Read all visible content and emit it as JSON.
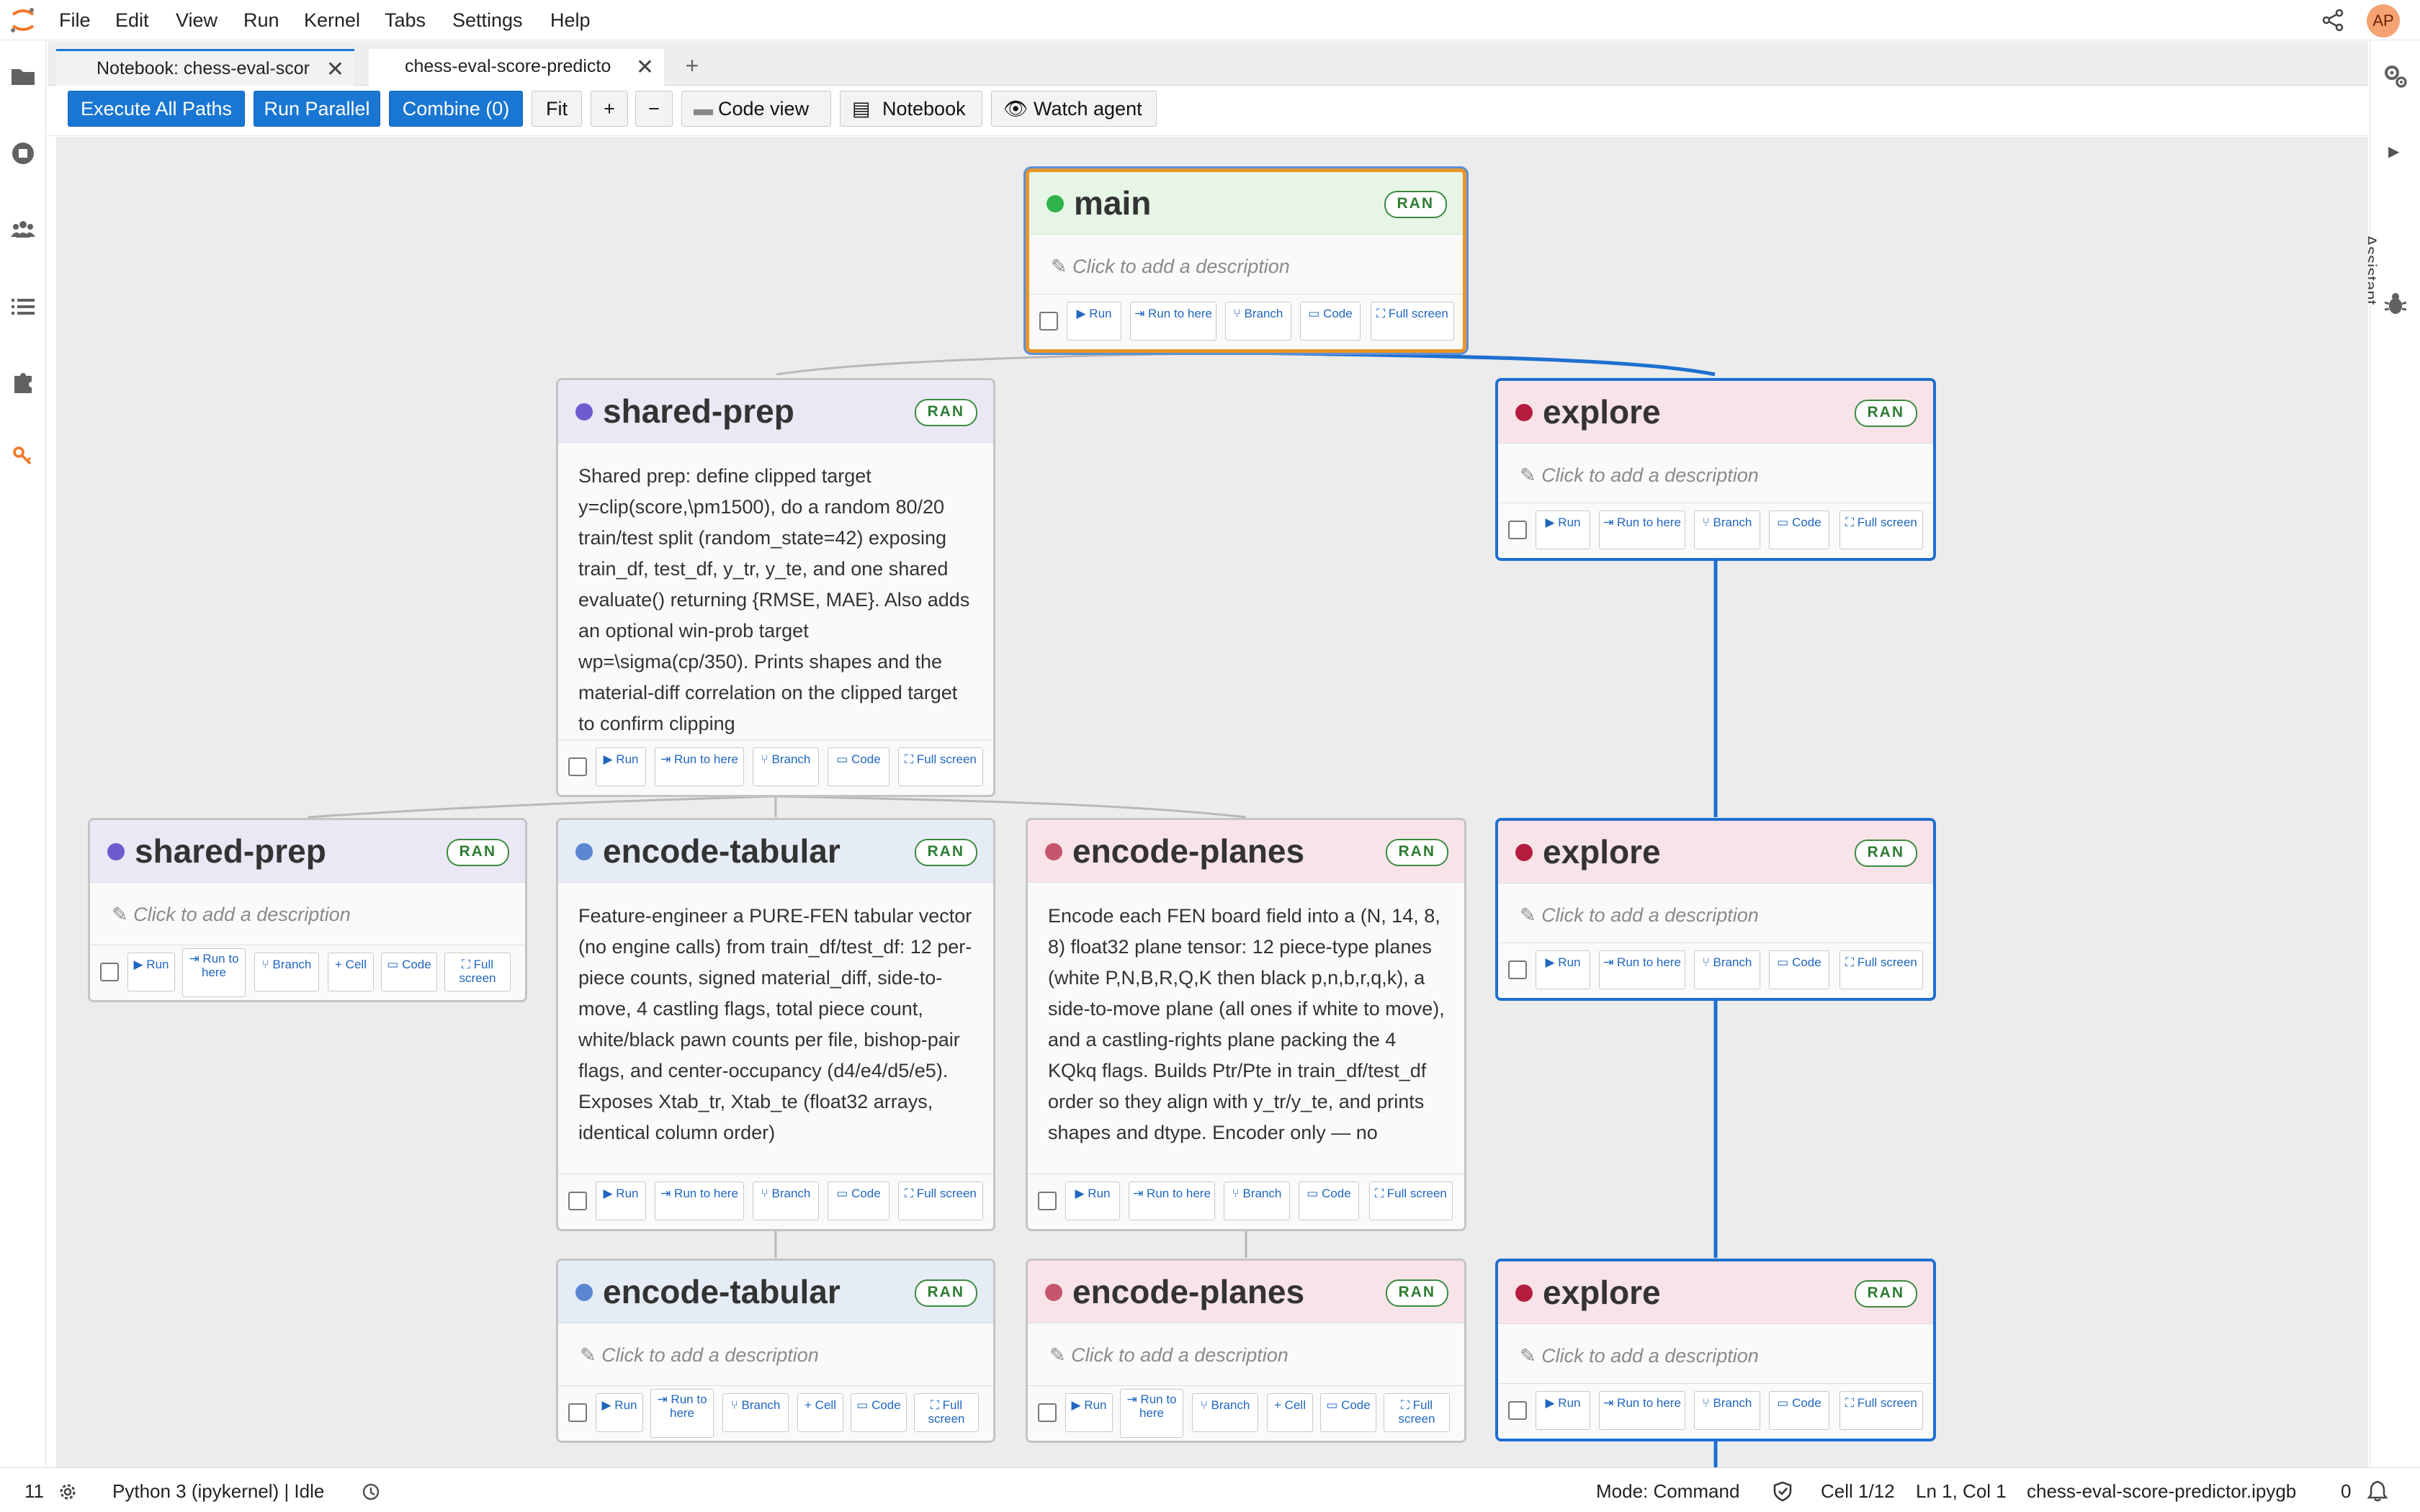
{
  "menu": [
    "File",
    "Edit",
    "View",
    "Run",
    "Kernel",
    "Tabs",
    "Settings",
    "Help"
  ],
  "user": {
    "initials": "AP"
  },
  "tabs": [
    {
      "label": "Notebook: chess-eval-scor"
    },
    {
      "label": "chess-eval-score-predicto"
    }
  ],
  "tab_close": "✕",
  "tab_add": "+",
  "toolbar": {
    "execute_all": "Execute All Paths",
    "run_parallel": "Run Parallel",
    "combine": "Combine (0)",
    "fit": "Fit",
    "zoom_in": "+",
    "zoom_out": "−",
    "code_view": "Code view",
    "notebook": "Notebook",
    "watch_agent": "Watch agent"
  },
  "assistant": "Assistant",
  "badge": "RAN",
  "placeholder": "✎ Click to add a description",
  "buttons": {
    "run": "▶ Run",
    "run_to_here": "⇥ Run to here",
    "run_to_here_stacked": "⇥ Run to here",
    "branch": "⑂ Branch",
    "code": "▭ Code",
    "cell": "+ Cell",
    "full_screen": "⛶ Full screen"
  },
  "nodes": {
    "main": {
      "title": "main"
    },
    "shared_prep_top": {
      "title": "shared-prep",
      "description": "Shared prep: define clipped target y=clip(score,\\pm1500), do a random 80/20 train/test split (random_state=42) exposing train_df, test_df, y_tr, y_te, and one shared evaluate() returning {RMSE, MAE}. Also adds an optional win-prob target wp=\\sigma(cp/350). Prints shapes and the material-diff correlation on the clipped target to confirm clipping"
    },
    "explore_1": {
      "title": "explore"
    },
    "shared_prep_2": {
      "title": "shared-prep"
    },
    "encode_tabular_1": {
      "title": "encode-tabular",
      "description": "Feature-engineer a PURE-FEN tabular vector (no engine calls) from train_df/test_df: 12 per-piece counts, signed material_diff, side-to-move, 4 castling flags, total piece count, white/black pawn counts per file, bishop-pair flags, and center-occupancy (d4/e4/d5/e5). Exposes Xtab_tr, Xtab_te (float32 arrays, identical column order)"
    },
    "encode_planes_1": {
      "title": "encode-planes",
      "description": "Encode each FEN board field into a (N, 14, 8, 8) float32 plane tensor: 12 piece-type planes (white P,N,B,R,Q,K then black p,n,b,r,q,k), a side-to-move plane (all ones if white to move), and a castling-rights plane packing the 4 KQkq flags. Builds Ptr/Pte in train_df/test_df order so they align with y_tr/y_te, and prints shapes and dtype. Encoder only — no"
    },
    "explore_2": {
      "title": "explore"
    },
    "encode_tabular_2": {
      "title": "encode-tabular"
    },
    "encode_planes_2": {
      "title": "encode-planes"
    },
    "explore_3": {
      "title": "explore"
    }
  },
  "status": {
    "count": "11",
    "kernel": "Python 3 (ipykernel) | Idle",
    "mode": "Mode: Command",
    "cell": "Cell 1/12",
    "cursor": "Ln 1, Col 1",
    "file": "chess-eval-score-predictor.ipygb",
    "notifications": "0"
  },
  "colors": {
    "accent": "#1976d2",
    "ran_green": "#2e7d32",
    "main_head": "#e6f5e6",
    "purple_head": "#eae8f5",
    "blue_head": "#e6ecf6",
    "pink_head": "#f8e4e8",
    "dot_green": "#2fb34a",
    "dot_purple": "#6e5ccf",
    "dot_blue": "#5b86d0",
    "dot_rose": "#c5566e",
    "dot_crimson": "#b51d3e"
  }
}
